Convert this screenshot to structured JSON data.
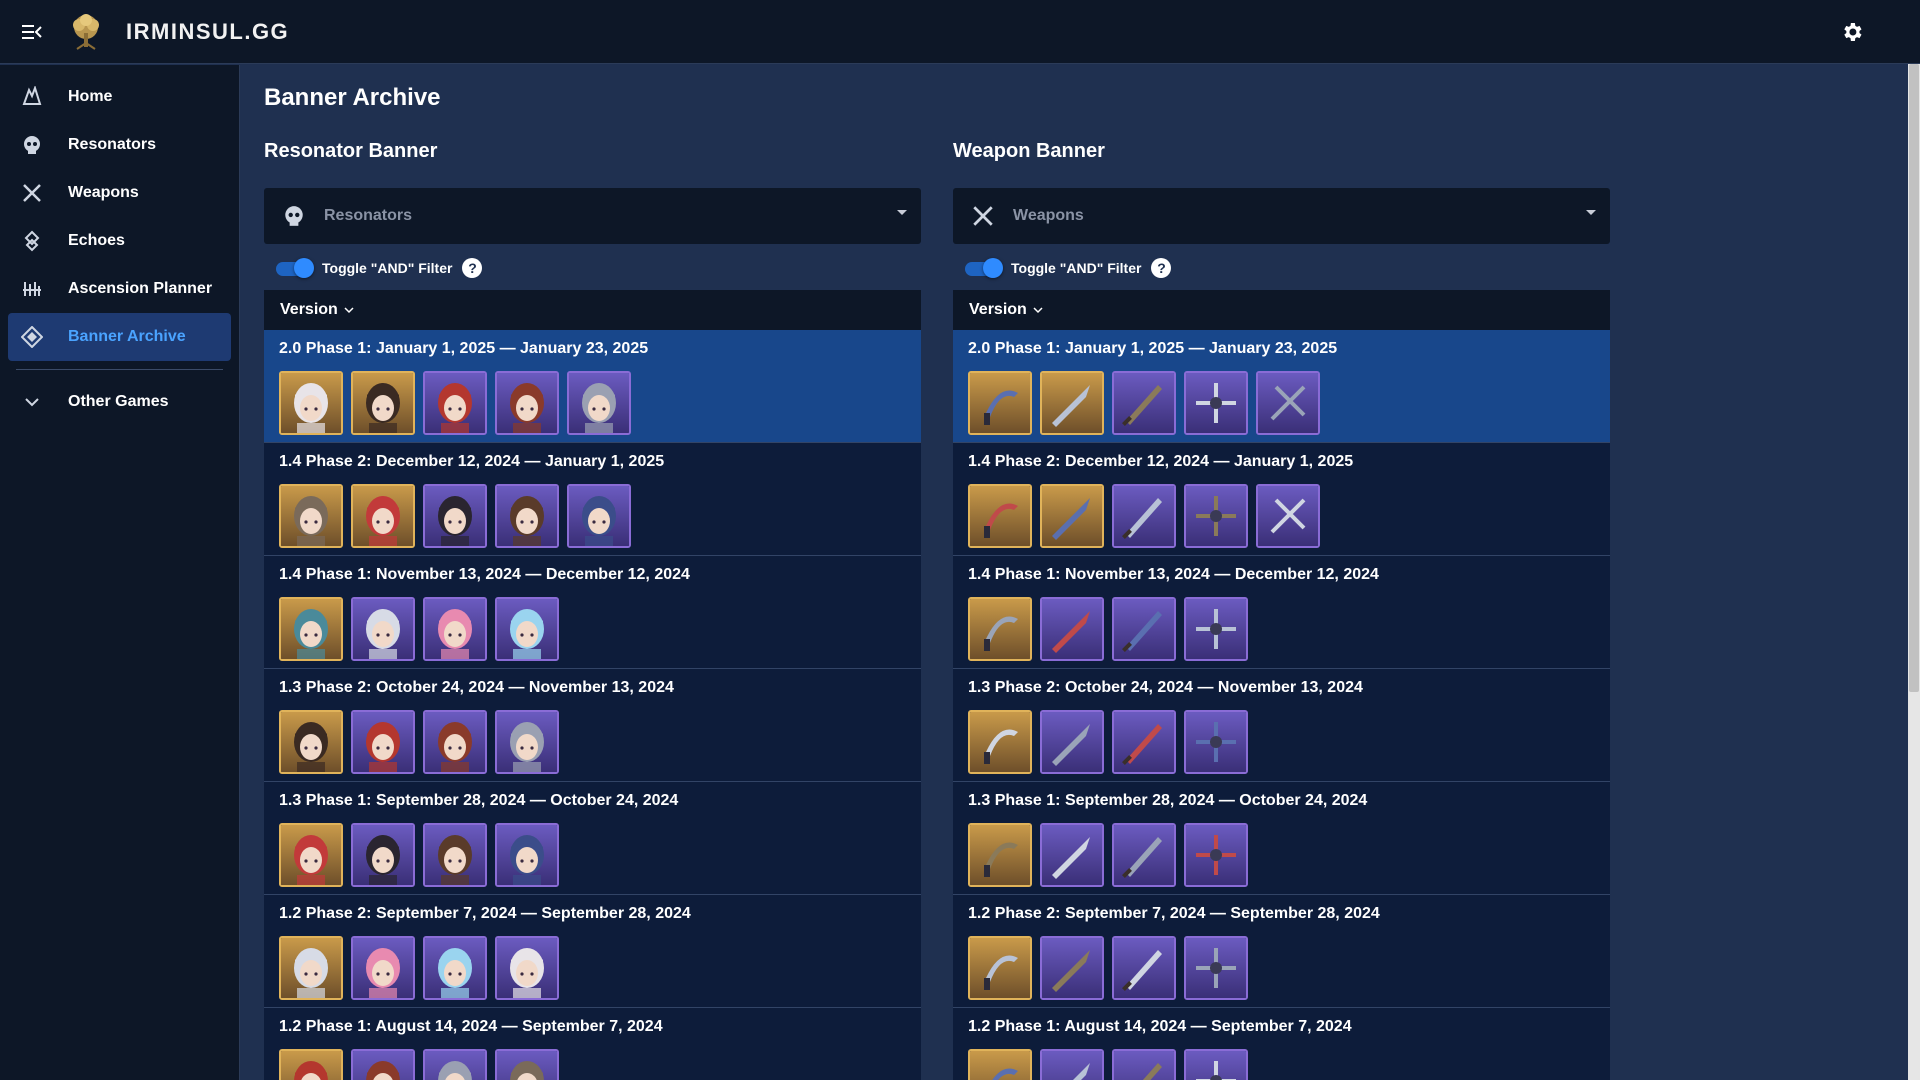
{
  "app": {
    "brand": "IRMINSUL.GG",
    "colors": {
      "topbar": "#0d1727",
      "background": "#1f3050",
      "accent": "#4aa3ff",
      "selected_row": "#18478b",
      "gold_rarity": "#e0b35a",
      "purple_rarity": "#8a6cd6"
    }
  },
  "topbar": {
    "menu_icon": "menu-collapse-icon",
    "logo_icon": "tree-logo-icon",
    "settings_icon": "gear-icon"
  },
  "sidebar": {
    "items": [
      {
        "label": "Home",
        "icon": "home-icon",
        "active": false
      },
      {
        "label": "Resonators",
        "icon": "resonator-head-icon",
        "active": false
      },
      {
        "label": "Weapons",
        "icon": "crossed-swords-icon",
        "active": false
      },
      {
        "label": "Echoes",
        "icon": "echo-icon",
        "active": false
      },
      {
        "label": "Ascension Planner",
        "icon": "planner-icon",
        "active": false
      },
      {
        "label": "Banner Archive",
        "icon": "banner-icon",
        "active": true
      }
    ],
    "other_games": {
      "label": "Other Games",
      "icon": "chevron-down-icon"
    }
  },
  "main": {
    "title": "Banner Archive",
    "resonator": {
      "title": "Resonator Banner",
      "select_placeholder": "Resonators",
      "toggle_label": "Toggle \"AND\" Filter",
      "help": "?",
      "column_header": "Version",
      "rows": [
        {
          "label": "2.0 Phase 1: January 1, 2025 — January 23, 2025",
          "selected": true,
          "thumbs": [
            "gold",
            "gold",
            "purple",
            "purple",
            "purple"
          ]
        },
        {
          "label": "1.4 Phase 2: December 12, 2024 — January 1, 2025",
          "selected": false,
          "thumbs": [
            "gold",
            "gold",
            "purple",
            "purple",
            "purple"
          ]
        },
        {
          "label": "1.4 Phase 1: November 13, 2024 — December 12, 2024",
          "selected": false,
          "thumbs": [
            "gold",
            "purple",
            "purple",
            "purple"
          ]
        },
        {
          "label": "1.3 Phase 2: October 24, 2024 — November 13, 2024",
          "selected": false,
          "thumbs": [
            "gold",
            "purple",
            "purple",
            "purple"
          ]
        },
        {
          "label": "1.3 Phase 1: September 28, 2024 — October 24, 2024",
          "selected": false,
          "thumbs": [
            "gold",
            "purple",
            "purple",
            "purple"
          ]
        },
        {
          "label": "1.2 Phase 2: September 7, 2024 — September 28, 2024",
          "selected": false,
          "thumbs": [
            "gold",
            "purple",
            "purple",
            "purple"
          ]
        },
        {
          "label": "1.2 Phase 1: August 14, 2024 — September 7, 2024",
          "selected": false,
          "thumbs": [
            "gold",
            "purple",
            "purple",
            "purple"
          ]
        }
      ]
    },
    "weapon": {
      "title": "Weapon Banner",
      "select_placeholder": "Weapons",
      "toggle_label": "Toggle \"AND\" Filter",
      "help": "?",
      "column_header": "Version",
      "rows": [
        {
          "label": "2.0 Phase 1: January 1, 2025 — January 23, 2025",
          "selected": true,
          "thumbs": [
            "gold",
            "gold",
            "purple",
            "purple",
            "purple"
          ]
        },
        {
          "label": "1.4 Phase 2: December 12, 2024 — January 1, 2025",
          "selected": false,
          "thumbs": [
            "gold",
            "gold",
            "purple",
            "purple",
            "purple"
          ]
        },
        {
          "label": "1.4 Phase 1: November 13, 2024 — December 12, 2024",
          "selected": false,
          "thumbs": [
            "gold",
            "purple",
            "purple",
            "purple"
          ]
        },
        {
          "label": "1.3 Phase 2: October 24, 2024 — November 13, 2024",
          "selected": false,
          "thumbs": [
            "gold",
            "purple",
            "purple",
            "purple"
          ]
        },
        {
          "label": "1.3 Phase 1: September 28, 2024 — October 24, 2024",
          "selected": false,
          "thumbs": [
            "gold",
            "purple",
            "purple",
            "purple"
          ]
        },
        {
          "label": "1.2 Phase 2: September 7, 2024 — September 28, 2024",
          "selected": false,
          "thumbs": [
            "gold",
            "purple",
            "purple",
            "purple"
          ]
        },
        {
          "label": "1.2 Phase 1: August 14, 2024 — September 7, 2024",
          "selected": false,
          "thumbs": [
            "gold",
            "purple",
            "purple",
            "purple"
          ]
        }
      ]
    }
  }
}
